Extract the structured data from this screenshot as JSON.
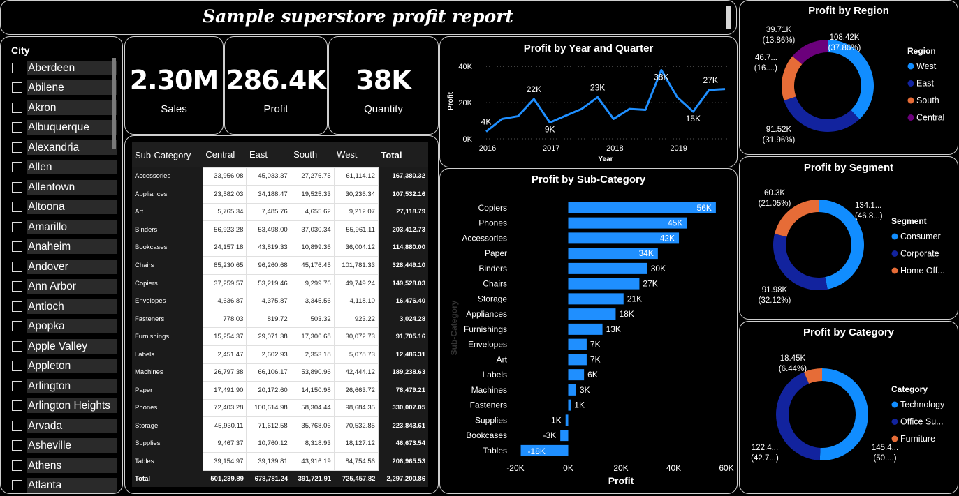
{
  "header": {
    "title": "Sample superstore profit report"
  },
  "slicer": {
    "title": "City",
    "cities": [
      "Aberdeen",
      "Abilene",
      "Akron",
      "Albuquerque",
      "Alexandria",
      "Allen",
      "Allentown",
      "Altoona",
      "Amarillo",
      "Anaheim",
      "Andover",
      "Ann Arbor",
      "Antioch",
      "Apopka",
      "Apple Valley",
      "Appleton",
      "Arlington",
      "Arlington Heights",
      "Arvada",
      "Asheville",
      "Athens",
      "Atlanta"
    ]
  },
  "kpis": {
    "sales": {
      "value": "2.30M",
      "label": "Sales"
    },
    "profit": {
      "value": "286.4K",
      "label": "Profit"
    },
    "quantity": {
      "value": "38K",
      "label": "Quantity"
    }
  },
  "matrix": {
    "headers": [
      "Sub-Category",
      "Central",
      "East",
      "South",
      "West",
      "Total"
    ],
    "rows": [
      [
        "Accessories",
        "33,956.08",
        "45,033.37",
        "27,276.75",
        "61,114.12",
        "167,380.32"
      ],
      [
        "Appliances",
        "23,582.03",
        "34,188.47",
        "19,525.33",
        "30,236.34",
        "107,532.16"
      ],
      [
        "Art",
        "5,765.34",
        "7,485.76",
        "4,655.62",
        "9,212.07",
        "27,118.79"
      ],
      [
        "Binders",
        "56,923.28",
        "53,498.00",
        "37,030.34",
        "55,961.11",
        "203,412.73"
      ],
      [
        "Bookcases",
        "24,157.18",
        "43,819.33",
        "10,899.36",
        "36,004.12",
        "114,880.00"
      ],
      [
        "Chairs",
        "85,230.65",
        "96,260.68",
        "45,176.45",
        "101,781.33",
        "328,449.10"
      ],
      [
        "Copiers",
        "37,259.57",
        "53,219.46",
        "9,299.76",
        "49,749.24",
        "149,528.03"
      ],
      [
        "Envelopes",
        "4,636.87",
        "4,375.87",
        "3,345.56",
        "4,118.10",
        "16,476.40"
      ],
      [
        "Fasteners",
        "778.03",
        "819.72",
        "503.32",
        "923.22",
        "3,024.28"
      ],
      [
        "Furnishings",
        "15,254.37",
        "29,071.38",
        "17,306.68",
        "30,072.73",
        "91,705.16"
      ],
      [
        "Labels",
        "2,451.47",
        "2,602.93",
        "2,353.18",
        "5,078.73",
        "12,486.31"
      ],
      [
        "Machines",
        "26,797.38",
        "66,106.17",
        "53,890.96",
        "42,444.12",
        "189,238.63"
      ],
      [
        "Paper",
        "17,491.90",
        "20,172.60",
        "14,150.98",
        "26,663.72",
        "78,479.21"
      ],
      [
        "Phones",
        "72,403.28",
        "100,614.98",
        "58,304.44",
        "98,684.35",
        "330,007.05"
      ],
      [
        "Storage",
        "45,930.11",
        "71,612.58",
        "35,768.06",
        "70,532.85",
        "223,843.61"
      ],
      [
        "Supplies",
        "9,467.37",
        "10,760.12",
        "8,318.93",
        "18,127.12",
        "46,673.54"
      ],
      [
        "Tables",
        "39,154.97",
        "39,139.81",
        "43,916.19",
        "84,754.56",
        "206,965.53"
      ]
    ],
    "total": [
      "Total",
      "501,239.89",
      "678,781.24",
      "391,721.91",
      "725,457.82",
      "2,297,200.86"
    ]
  },
  "chart_data": [
    {
      "type": "line",
      "title": "Profit by Year and Quarter",
      "xlabel": "Year",
      "ylabel": "Profit",
      "x_ticks": [
        "2016",
        "2017",
        "2018",
        "2019"
      ],
      "y_ticks": [
        "0K",
        "20K",
        "40K"
      ],
      "ylim": [
        0,
        42000
      ],
      "values": [
        4000,
        11000,
        12500,
        22000,
        9000,
        12800,
        16500,
        23000,
        11000,
        16500,
        16000,
        38000,
        23000,
        15000,
        27000,
        27500
      ],
      "data_labels": {
        "0": "4K",
        "3": "22K",
        "4": "9K",
        "7": "23K",
        "11": "38K",
        "13": "15K",
        "14": "27K"
      },
      "color": "#1f8fff"
    },
    {
      "type": "bar",
      "orientation": "horizontal",
      "title": "Profit by Sub-Category",
      "xlabel": "Profit",
      "ylabel": "Sub-Category",
      "categories": [
        "Copiers",
        "Phones",
        "Accessories",
        "Paper",
        "Binders",
        "Chairs",
        "Storage",
        "Appliances",
        "Furnishings",
        "Envelopes",
        "Art",
        "Labels",
        "Machines",
        "Fasteners",
        "Supplies",
        "Bookcases",
        "Tables"
      ],
      "values": [
        56000,
        45000,
        42000,
        34000,
        30000,
        27000,
        21000,
        18000,
        13000,
        7000,
        7000,
        6000,
        3000,
        1000,
        -1000,
        -3000,
        -18000
      ],
      "labels": [
        "56K",
        "45K",
        "42K",
        "34K",
        "30K",
        "27K",
        "21K",
        "18K",
        "13K",
        "7K",
        "7K",
        "6K",
        "3K",
        "1K",
        "-1K",
        "-3K",
        "-18K"
      ],
      "x_ticks": [
        "-20K",
        "0K",
        "20K",
        "40K",
        "60K"
      ],
      "xlim": [
        -20000,
        60000
      ],
      "color": "#1f8fff"
    },
    {
      "type": "pie",
      "title": "Profit by Region",
      "legend_title": "Region",
      "labels": [
        "West",
        "East",
        "South",
        "Central"
      ],
      "values": [
        108420,
        91520,
        46700,
        39710
      ],
      "colors": [
        "#118DFF",
        "#12239E",
        "#E66C37",
        "#6B007B"
      ],
      "slice_labels": [
        "108.42K\n(37.86%)",
        "91.52K\n(31.96%)",
        "46.7...\n(16....)",
        "39.71K\n(13.86%)"
      ]
    },
    {
      "type": "pie",
      "title": "Profit by Segment",
      "legend_title": "Segment",
      "labels": [
        "Consumer",
        "Corporate",
        "Home Off..."
      ],
      "values": [
        134100,
        91980,
        60300
      ],
      "colors": [
        "#118DFF",
        "#12239E",
        "#E66C37"
      ],
      "slice_labels": [
        "134.1...\n(46.8...)",
        "91.98K\n(32.12%)",
        "60.3K\n(21.05%)"
      ]
    },
    {
      "type": "pie",
      "title": "Profit by Category",
      "legend_title": "Category",
      "labels": [
        "Technology",
        "Office Su...",
        "Furniture"
      ],
      "values": [
        145400,
        122400,
        18450
      ],
      "colors": [
        "#118DFF",
        "#12239E",
        "#E66C37"
      ],
      "slice_labels": [
        "145.4...\n(50....)",
        "122.4...\n(42.7...)",
        "18.45K\n(6.44%)"
      ]
    }
  ]
}
